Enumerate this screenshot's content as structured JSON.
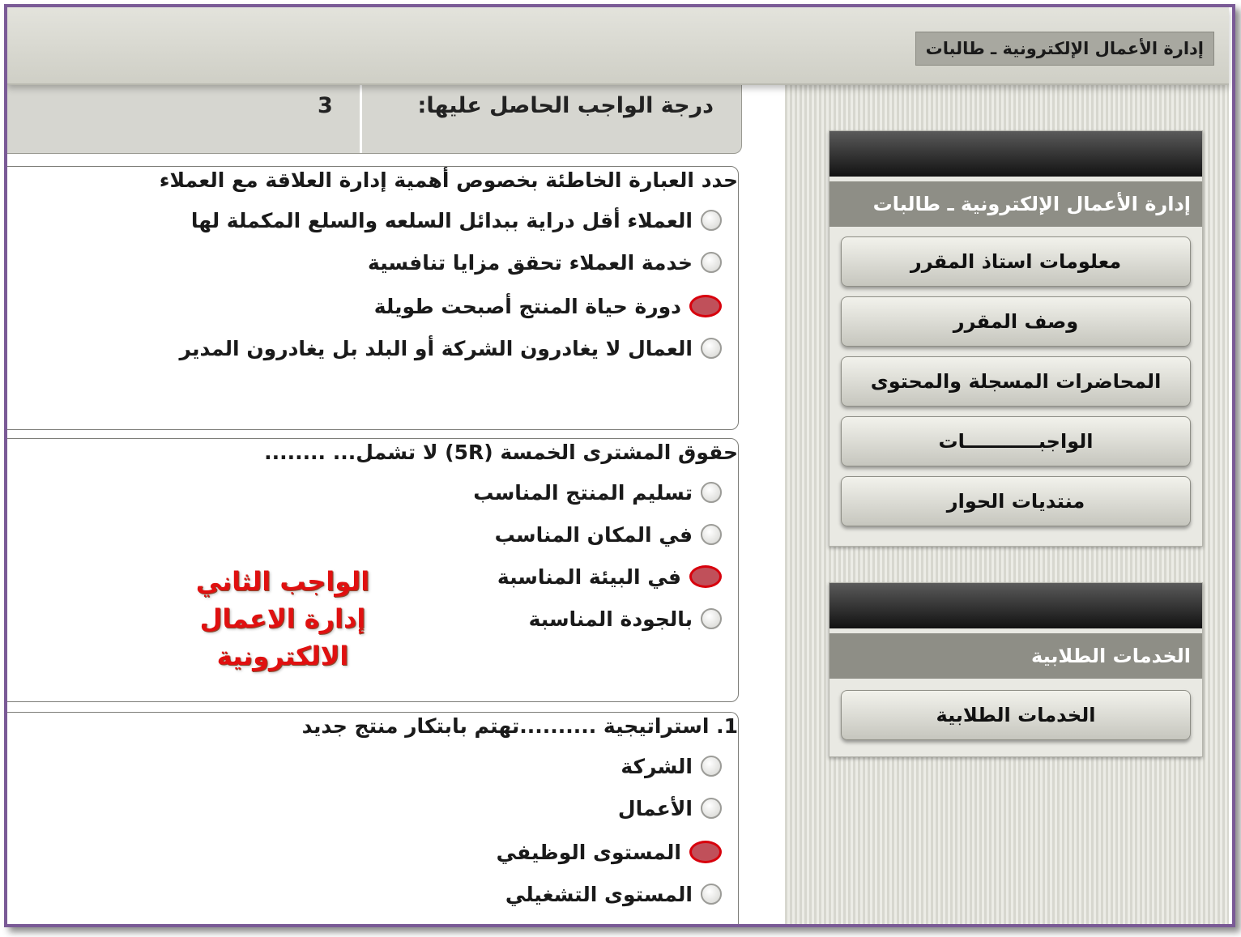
{
  "header": {
    "title": "إدارة الأعمال الإلكترونية ـ طالبات"
  },
  "grade": {
    "label": "درجة الواجب الحاصل عليها:",
    "value": "3"
  },
  "questions": [
    {
      "text": "حدد العبارة الخاطئة بخصوص أهمية إدارة العلاقة مع العملاء",
      "options": [
        "العملاء أقل دراية ببدائل السلعه والسلع المكملة لها",
        "خدمة العملاء تحقق مزايا تنافسية",
        "دورة حياة المنتج أصبحت طويلة",
        "العمال لا يغادرون الشركة أو البلد بل يغادرون المدير"
      ],
      "selected": 2
    },
    {
      "text": "حقوق المشترى الخمسة (5R) لا تشمل... ........",
      "options": [
        "تسليم المنتج المناسب",
        "في المكان المناسب",
        "في البيئة المناسبة",
        "بالجودة المناسبة"
      ],
      "selected": 2
    },
    {
      "text": "1. استراتيجية ..........تهتم بابتكار منتج جديد",
      "options": [
        "الشركة",
        "الأعمال",
        "المستوى الوظيفي",
        "المستوى التشغيلي"
      ],
      "selected": 2
    }
  ],
  "stamp": {
    "line1": "الواجب الثاني",
    "line2": "إدارة الاعمال الالكترونية"
  },
  "sidebar": {
    "course_panel": {
      "title": "إدارة الأعمال الإلكترونية ـ طالبات",
      "items": [
        "معلومات استاذ المقرر",
        "وصف المقرر",
        "المحاضرات المسجلة والمحتوى",
        "الواجبـــــــــــات",
        "منتديات الحوار"
      ]
    },
    "services_panel": {
      "title": "الخدمات الطلابية",
      "items": [
        "الخدمات الطلابية"
      ]
    }
  }
}
